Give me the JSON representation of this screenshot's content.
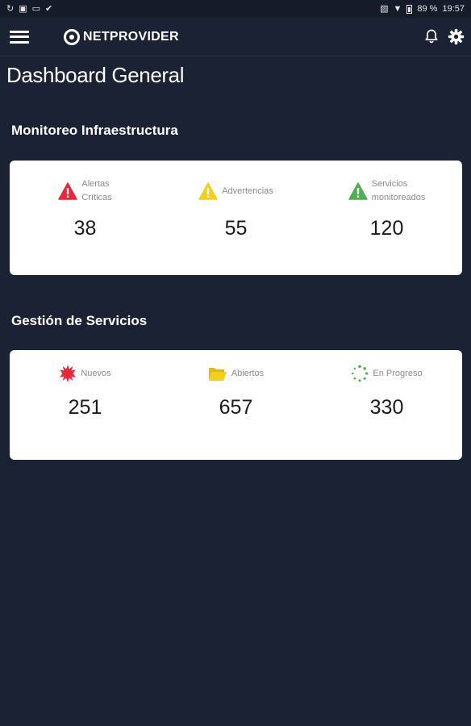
{
  "status_bar": {
    "battery": "89 %",
    "time": "19:57"
  },
  "app": {
    "brand": "NETPROVIDER"
  },
  "page": {
    "title": "Dashboard General"
  },
  "infra": {
    "title": "Monitoreo Infraestructura",
    "stats": [
      {
        "label_line1": "Alertas",
        "label_line2": "Críticas",
        "value": "38",
        "icon": "warning-icon",
        "color": "#e8273b"
      },
      {
        "label_line1": "Advertencias",
        "label_line2": "",
        "value": "55",
        "icon": "warning-icon",
        "color": "#f2cf1d"
      },
      {
        "label_line1": "Servicios",
        "label_line2": "monitoreados",
        "value": "120",
        "icon": "warning-icon",
        "color": "#4caf50"
      }
    ]
  },
  "services": {
    "title": "Gestión de Servicios",
    "stats": [
      {
        "label": "Nuevos",
        "value": "251",
        "icon": "burst-icon",
        "color": "#e8273b"
      },
      {
        "label": "Abiertos",
        "value": "657",
        "icon": "folder-open-icon",
        "color": "#f2cf1d"
      },
      {
        "label": "En Progreso",
        "value": "330",
        "icon": "spinner-icon",
        "color": "#4caf50"
      }
    ]
  }
}
